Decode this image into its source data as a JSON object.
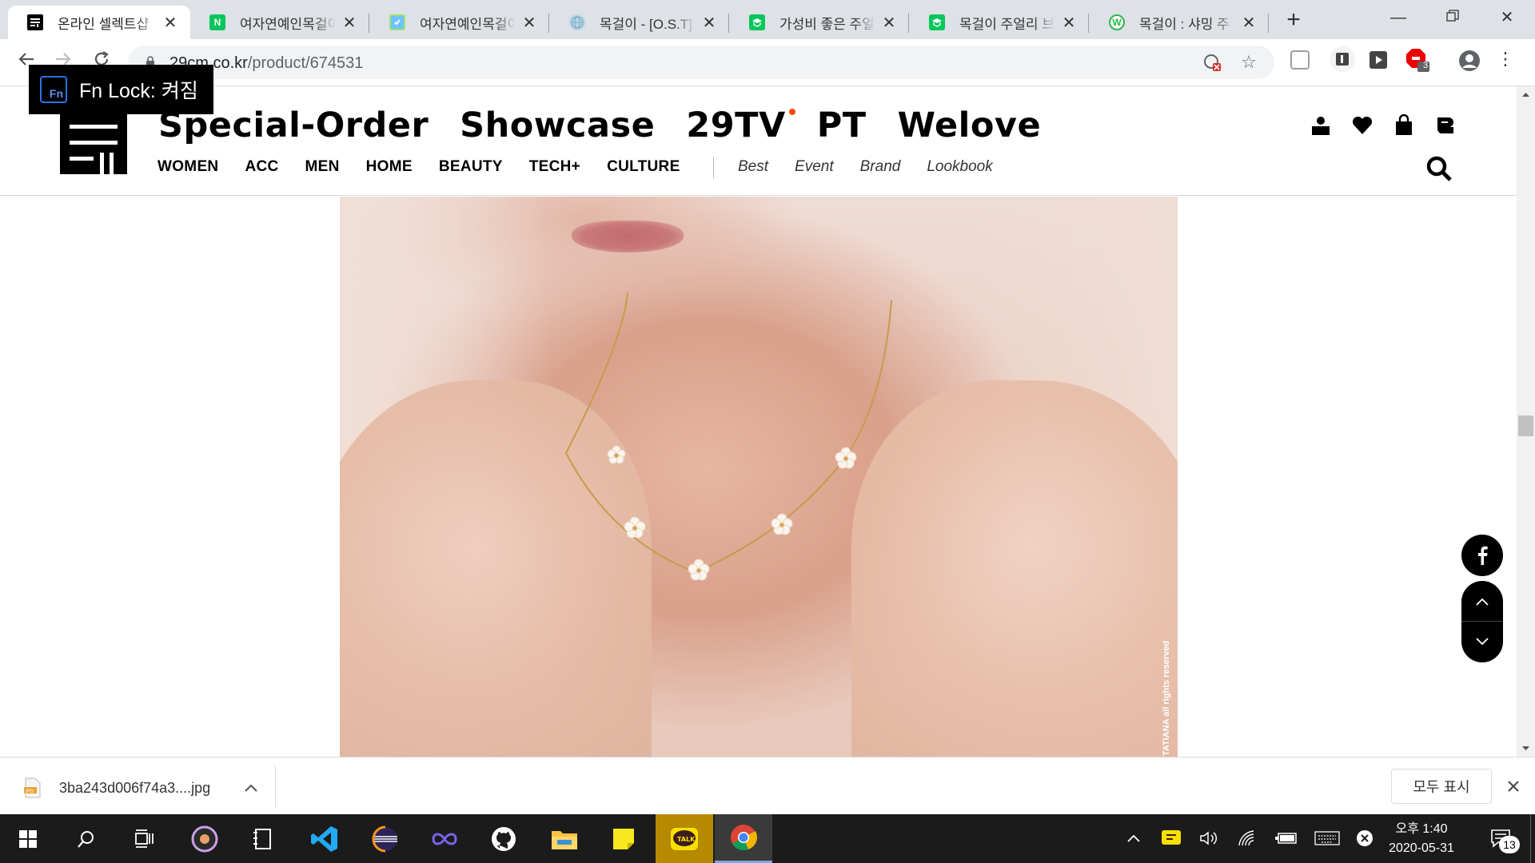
{
  "tabs": [
    {
      "title": "온라인 셀렉트샵",
      "favicon": "29cm-icon",
      "active": true
    },
    {
      "title": "여자연예인목걸이",
      "favicon": "naver-icon",
      "active": false
    },
    {
      "title": "여자연예인목걸이",
      "favicon": "blog-icon",
      "active": false
    },
    {
      "title": "목걸이 - [O.S.T]",
      "favicon": "globe-icon",
      "active": false
    },
    {
      "title": "가성비 좋은 주얼리",
      "favicon": "cafe-icon",
      "active": false
    },
    {
      "title": "목걸이 주얼리 브랜드",
      "favicon": "cafe-icon",
      "active": false
    },
    {
      "title": "목걸이 : 샤밍 주",
      "favicon": "shop-icon",
      "active": false
    }
  ],
  "address": {
    "domain": "29cm.co.kr",
    "path": "/product/674531"
  },
  "osd": {
    "label": "Fn Lock: 켜짐"
  },
  "header": {
    "main_menu": [
      "Special-Order",
      "Showcase",
      "29TV",
      "PT",
      "Welove"
    ],
    "categories": [
      "WOMEN",
      "ACC",
      "MEN",
      "HOME",
      "BEAUTY",
      "TECH+",
      "CULTURE"
    ],
    "sub_menu": [
      "Best",
      "Event",
      "Brand",
      "Lookbook"
    ]
  },
  "product_image": {
    "watermark": "TATIANA all rights reserved"
  },
  "download": {
    "filename": "3ba243d006f74a3....jpg",
    "show_all_label": "모두 표시"
  },
  "system": {
    "time_label": "오후 1:40",
    "date_label": "2020-05-31",
    "notification_count": "13",
    "extension_badge": "3"
  },
  "colors": {
    "accent_dot": "#ff4800",
    "tab_strip": "#dee1e6",
    "taskbar": "#1b1b1b"
  }
}
